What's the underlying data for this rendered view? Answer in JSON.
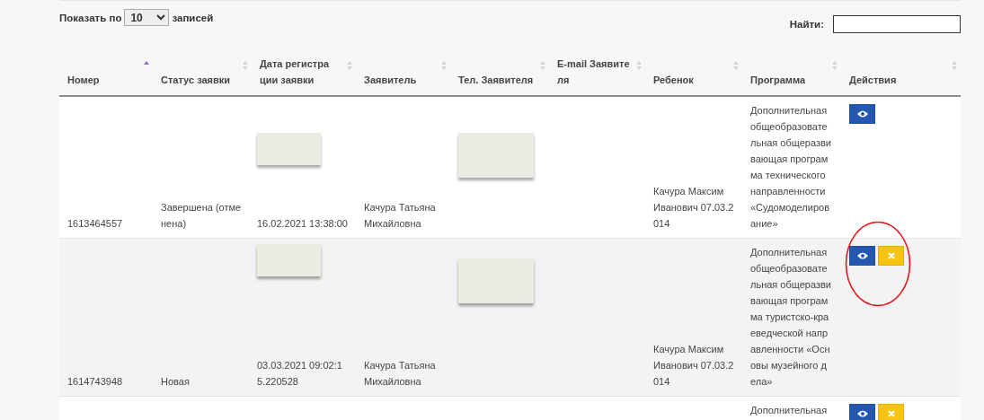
{
  "length_menu": {
    "prefix": "Показать по",
    "value": "10",
    "suffix": "записей"
  },
  "search": {
    "label": "Найти:"
  },
  "table": {
    "columns": [
      {
        "lines": [
          "Номер"
        ],
        "sorted": true
      },
      {
        "lines": [
          "Статус заявки"
        ],
        "sorted": false
      },
      {
        "lines": [
          "Дата регистра",
          "ции заявки"
        ],
        "sorted": false
      },
      {
        "lines": [
          "Заявитель"
        ],
        "sorted": false
      },
      {
        "lines": [
          "Тел. Заявителя"
        ],
        "sorted": false
      },
      {
        "lines": [
          "E-mail Заявите",
          "ля"
        ],
        "sorted": false
      },
      {
        "lines": [
          "Ребенок"
        ],
        "sorted": false
      },
      {
        "lines": [
          "Программа"
        ],
        "sorted": false
      },
      {
        "lines": [
          "Действия"
        ],
        "sorted": false
      }
    ],
    "rows": [
      {
        "number": "1613464557",
        "status": [
          "Завершена (отме",
          "нена)"
        ],
        "date_redacted": true,
        "date": [
          "16.02.2021 13:38:00"
        ],
        "applicant": [
          "Качура Татьяна",
          "Михайловна"
        ],
        "phone_redacted": true,
        "child": [
          "Качура Максим",
          "Иванович 07.03.2",
          "014"
        ],
        "program": [
          "Дополнительная",
          "общеобразовате",
          "льная общеразви",
          "вающая програм",
          "ма технического",
          "направленности",
          "«Судомоделиров",
          "ание»"
        ],
        "actions": [
          {
            "kind": "view"
          }
        ],
        "highlighted": false
      },
      {
        "number": "1614743948",
        "status": [
          "Новая"
        ],
        "date_redacted": true,
        "date": [
          "03.03.2021 09:02:1",
          "5.220528"
        ],
        "applicant": [
          "Качура Татьяна",
          "Михайловна"
        ],
        "phone_redacted": true,
        "child": [
          "Качура Максим",
          "Иванович 07.03.2",
          "014"
        ],
        "program": [
          "Дополнительная",
          "общеобразовате",
          "льная общеразви",
          "вающая програм",
          "ма туристско-кра",
          "еведческой напр",
          "авленности «Осн",
          "овы музейного д",
          "ела»"
        ],
        "actions": [
          {
            "kind": "view"
          },
          {
            "kind": "cancel"
          }
        ],
        "highlighted": true
      },
      {
        "program": [
          "Дополнительная"
        ],
        "actions": [
          {
            "kind": "view"
          },
          {
            "kind": "cancel"
          }
        ],
        "highlighted": false
      }
    ]
  }
}
